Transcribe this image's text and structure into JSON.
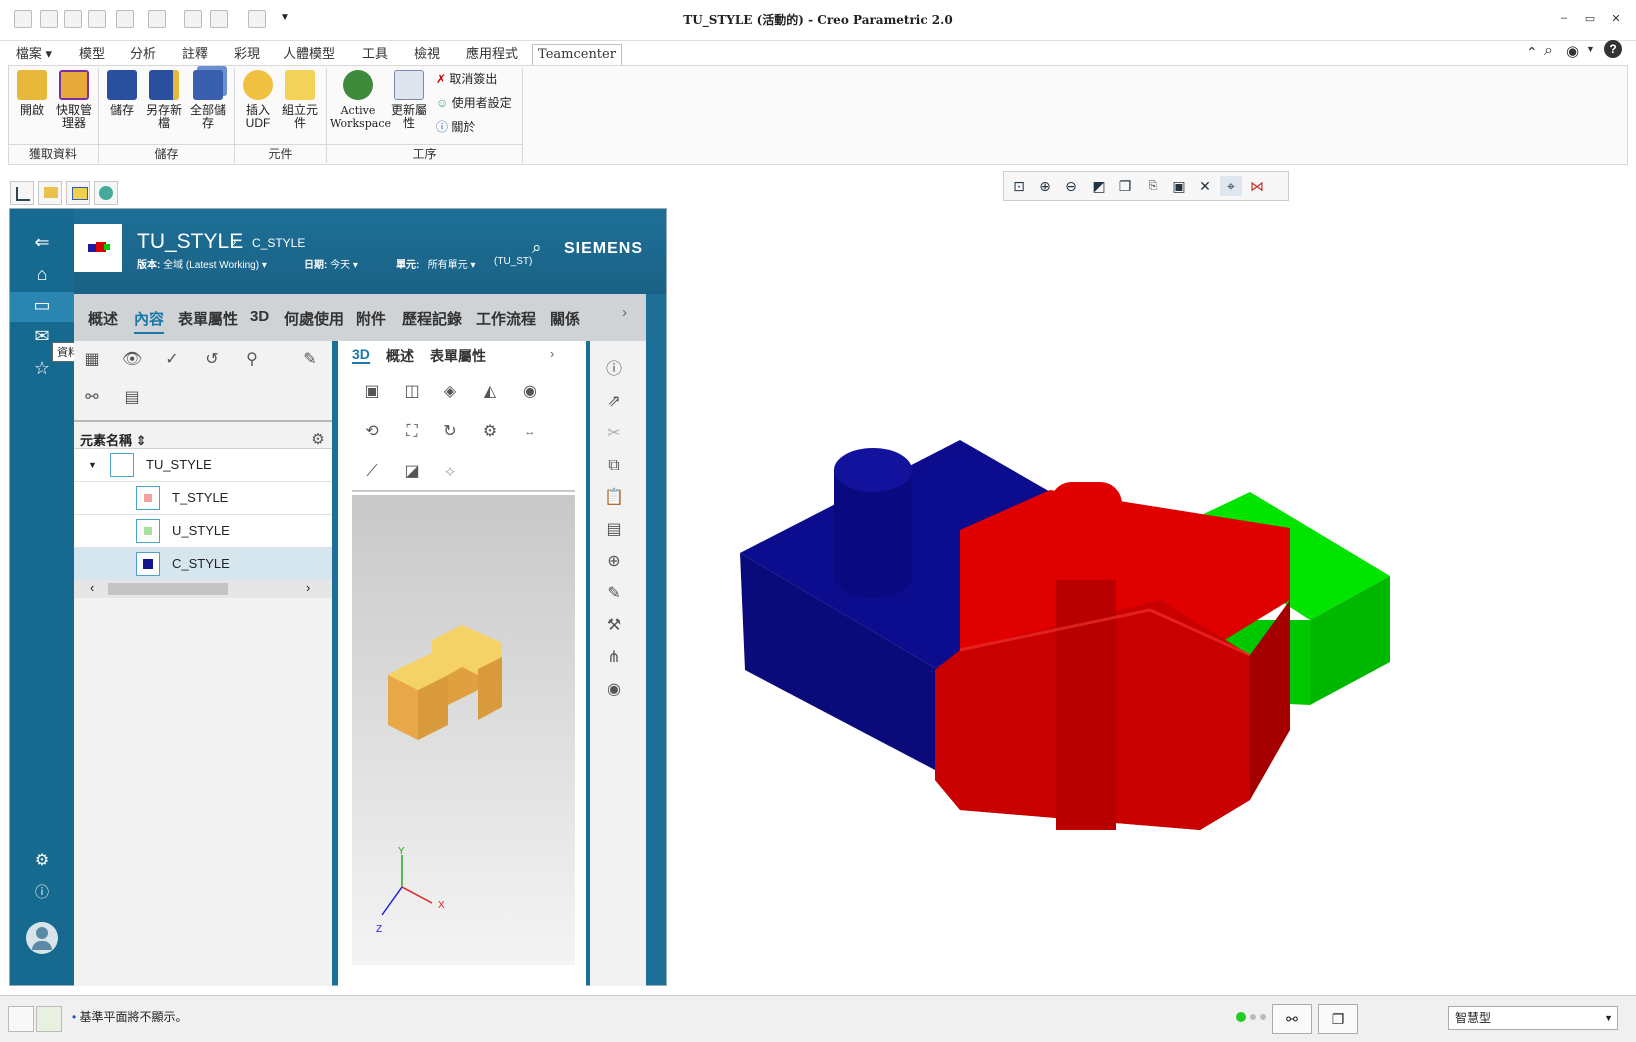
{
  "window": {
    "title": "TU_STYLE (活動的) - Creo Parametric 2.0"
  },
  "ribbon": {
    "tabs": [
      "檔案",
      "模型",
      "分析",
      "註釋",
      "彩現",
      "人體模型",
      "工具",
      "檢視",
      "應用程式",
      "Teamcenter"
    ],
    "active_tab": "Teamcenter",
    "groups": {
      "get_data": {
        "label": "獲取資料",
        "buttons": [
          "開啟",
          "快取管理器"
        ]
      },
      "save": {
        "label": "儲存",
        "buttons": [
          "儲存",
          "另存新檔",
          "全部儲存"
        ]
      },
      "component": {
        "label": "元件",
        "buttons": [
          "插入UDF",
          "組立元件"
        ]
      },
      "process": {
        "label": "工序",
        "buttons": [
          "Active Workspace",
          "更新屬性"
        ],
        "menu": [
          "取消簽出",
          "使用者設定",
          "關於"
        ]
      }
    }
  },
  "teamcenter": {
    "brand": "SIEMENS",
    "title": "TU_STYLE",
    "breadcrumb": "C_STYLE",
    "revision_label": "版本:",
    "revision_value": "全域 (Latest Working)",
    "date_label": "日期:",
    "date_value": "今天",
    "unit_label": "單元:",
    "unit_value": "所有單元",
    "unit_extra": "(TU_ST)",
    "tooltip": "資料夾",
    "tabs": [
      "概述",
      "內容",
      "表單屬性",
      "3D",
      "何處使用",
      "附件",
      "歷程記錄",
      "工作流程",
      "關係"
    ],
    "active_tab": "內容",
    "tree_header": "元素名稱",
    "tree": [
      "TU_STYLE",
      "T_STYLE",
      "U_STYLE",
      "C_STYLE"
    ],
    "selected_row": "C_STYLE",
    "preview_tabs": [
      "3D",
      "概述",
      "表單屬性"
    ],
    "axes": {
      "x": "X",
      "y": "Y",
      "z": "Z"
    }
  },
  "status": {
    "message": "基準平面將不顯示。",
    "filter": "智慧型"
  },
  "colors": {
    "blue_part": "#0a0a85",
    "red_part": "#e00000",
    "green_part": "#00dd00",
    "preview_part": "#f5c060",
    "tc_teal": "#1a6b90"
  }
}
